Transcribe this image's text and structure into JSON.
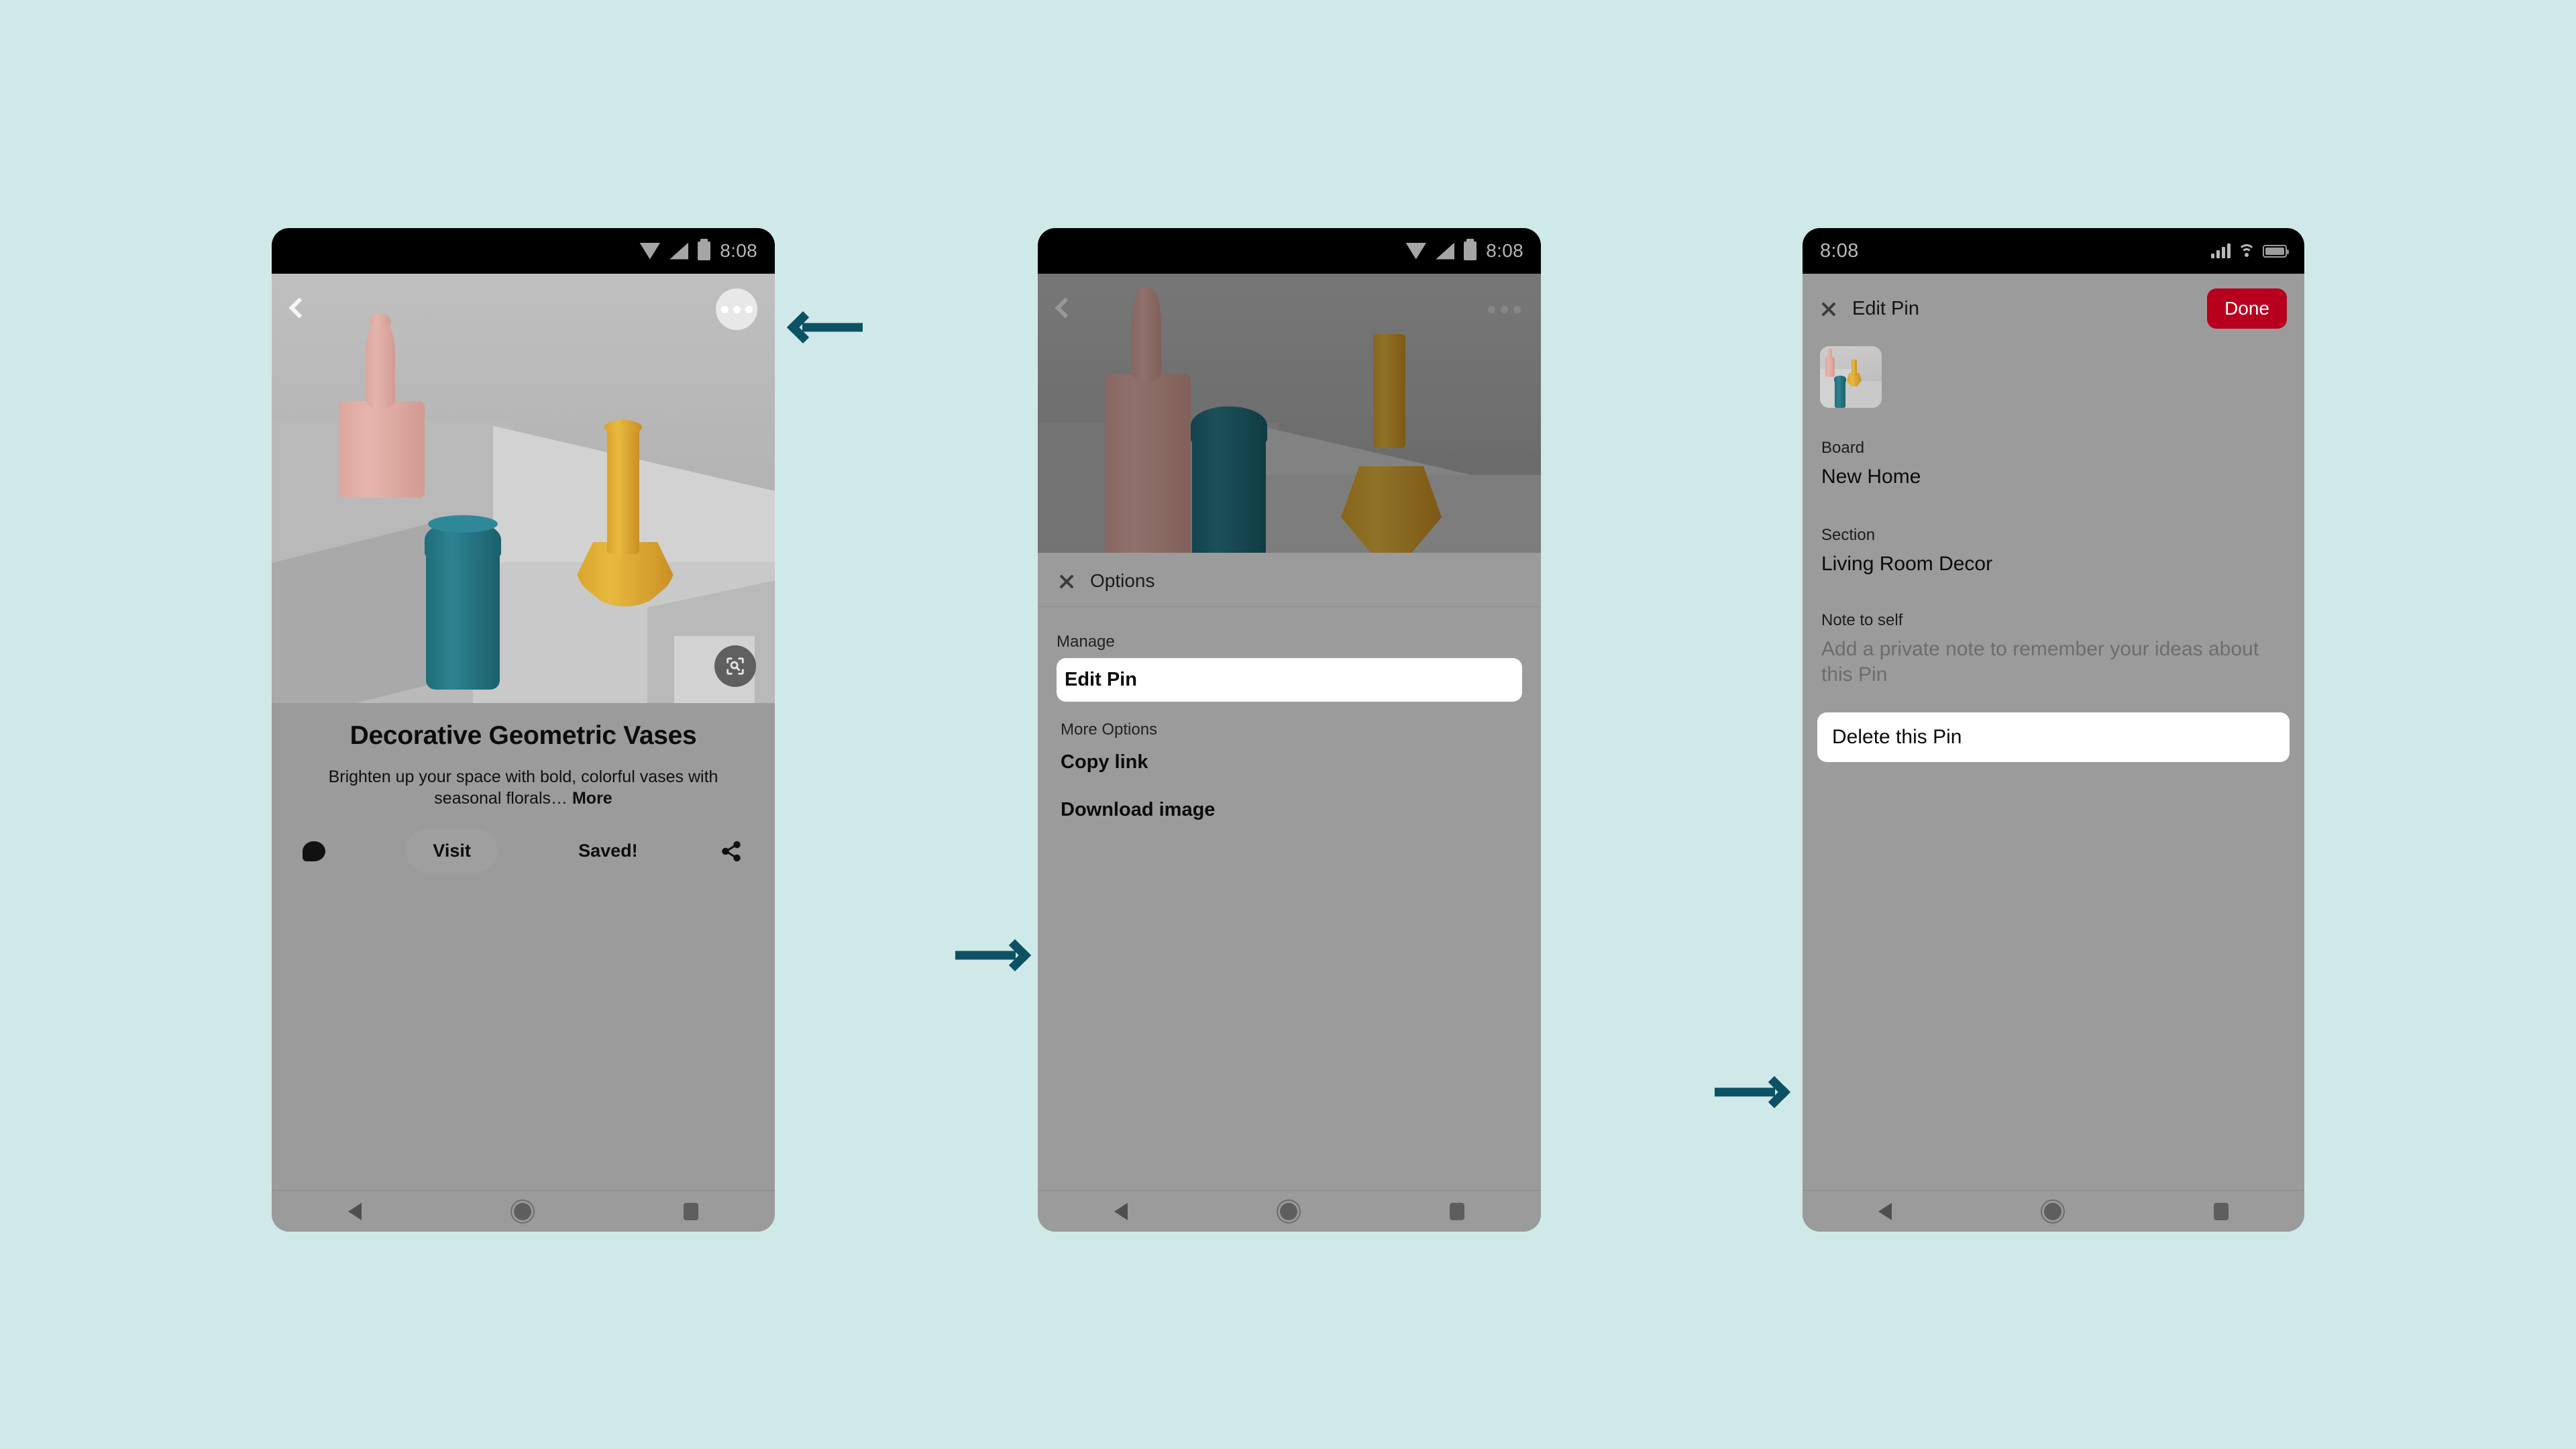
{
  "background_color": "#cfe9e8",
  "accent_color": "#0d5264",
  "brand_red": "#b8001e",
  "screens": [
    {
      "id": "pin-detail",
      "platform": "android",
      "status_bar": {
        "time": "8:08",
        "icons": [
          "wifi-icon",
          "cellular-signal-icon",
          "battery-icon"
        ]
      },
      "overlay": {
        "back_icon": "chevron-left-icon",
        "more_options_icon": "more-options-icon",
        "visual_search_icon": "visual-search-icon"
      },
      "pin": {
        "title": "Decorative Geometric Vases",
        "description": "Brighten up your space with bold, colorful vases with seasonal florals…",
        "more_label": "More",
        "comment_icon": "comment-icon",
        "visit_label": "Visit",
        "saved_label": "Saved!",
        "share_icon": "share-icon"
      },
      "navbar": [
        "back-nav-icon",
        "home-nav-icon",
        "recents-nav-icon"
      ]
    },
    {
      "id": "options-sheet",
      "platform": "android",
      "status_bar": {
        "time": "8:08",
        "icons": [
          "wifi-icon",
          "cellular-signal-icon",
          "battery-icon"
        ]
      },
      "overlay": {
        "back_icon": "chevron-left-icon",
        "more_options_icon": "more-options-icon"
      },
      "sheet": {
        "close_icon": "close-icon",
        "title": "Options",
        "groups": [
          {
            "label": "Manage",
            "items": [
              {
                "label": "Edit Pin",
                "highlighted": true
              }
            ]
          },
          {
            "label": "More Options",
            "items": [
              {
                "label": "Copy link",
                "highlighted": false
              },
              {
                "label": "Download image",
                "highlighted": false
              }
            ]
          }
        ]
      },
      "navbar": [
        "back-nav-icon",
        "home-nav-icon",
        "recents-nav-icon"
      ]
    },
    {
      "id": "edit-pin",
      "platform": "ios",
      "status_bar": {
        "time": "8:08",
        "icons": [
          "cellular-bars-icon",
          "wifi-icon",
          "battery-icon"
        ]
      },
      "header": {
        "close_icon": "close-icon",
        "title": "Edit Pin",
        "done_label": "Done"
      },
      "thumbnail": "pin-thumbnail",
      "fields": [
        {
          "label": "Board",
          "value": "New Home",
          "is_placeholder": false
        },
        {
          "label": "Section",
          "value": "Living Room Decor",
          "is_placeholder": false
        },
        {
          "label": "Note to self",
          "value": "Add a private note to remember your ideas about this Pin",
          "is_placeholder": true
        }
      ],
      "delete_label": "Delete this Pin",
      "navbar": [
        "back-nav-icon",
        "home-nav-icon",
        "recents-nav-icon"
      ]
    }
  ],
  "arrows": [
    {
      "id": "arrow-to-more-options",
      "direction": "left"
    },
    {
      "id": "arrow-to-edit-pin",
      "direction": "right"
    },
    {
      "id": "arrow-to-delete-pin",
      "direction": "right"
    }
  ]
}
